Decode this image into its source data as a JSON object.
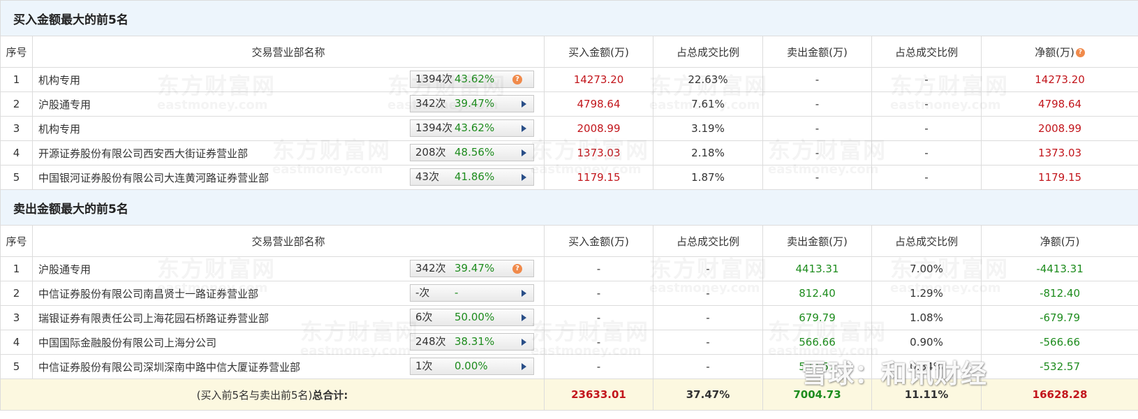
{
  "buy_section": {
    "title": "买入金额最大的前5名",
    "headers": [
      "序号",
      "交易营业部名称",
      "买入金额(万)",
      "占总成交比例",
      "卖出金额(万)",
      "占总成交比例",
      "净额(万)"
    ],
    "rows": [
      {
        "idx": "1",
        "name": "机构专用",
        "count": "1394次",
        "pct": "43.62%",
        "icon": "question-icon",
        "buy": "14273.20",
        "buy_ratio": "22.63%",
        "sell": "-",
        "sell_ratio": "-",
        "net": "14273.20"
      },
      {
        "idx": "2",
        "name": "沪股通专用",
        "count": "342次",
        "pct": "39.47%",
        "icon": "arrow-right-icon",
        "buy": "4798.64",
        "buy_ratio": "7.61%",
        "sell": "-",
        "sell_ratio": "-",
        "net": "4798.64"
      },
      {
        "idx": "3",
        "name": "机构专用",
        "count": "1394次",
        "pct": "43.62%",
        "icon": "arrow-right-icon",
        "buy": "2008.99",
        "buy_ratio": "3.19%",
        "sell": "-",
        "sell_ratio": "-",
        "net": "2008.99"
      },
      {
        "idx": "4",
        "name": "开源证券股份有限公司西安西大街证券营业部",
        "count": "208次",
        "pct": "48.56%",
        "icon": "arrow-right-icon",
        "buy": "1373.03",
        "buy_ratio": "2.18%",
        "sell": "-",
        "sell_ratio": "-",
        "net": "1373.03"
      },
      {
        "idx": "5",
        "name": "中国银河证券股份有限公司大连黄河路证券营业部",
        "count": "43次",
        "pct": "41.86%",
        "icon": "arrow-right-icon",
        "buy": "1179.15",
        "buy_ratio": "1.87%",
        "sell": "-",
        "sell_ratio": "-",
        "net": "1179.15"
      }
    ]
  },
  "sell_section": {
    "title": "卖出金额最大的前5名",
    "headers": [
      "序号",
      "交易营业部名称",
      "买入金额(万)",
      "占总成交比例",
      "卖出金额(万)",
      "占总成交比例",
      "净额(万)"
    ],
    "rows": [
      {
        "idx": "1",
        "name": "沪股通专用",
        "count": "342次",
        "pct": "39.47%",
        "icon": "question-icon",
        "buy": "-",
        "buy_ratio": "-",
        "sell": "4413.31",
        "sell_ratio": "7.00%",
        "net": "-4413.31"
      },
      {
        "idx": "2",
        "name": "中信证券股份有限公司南昌贤士一路证券营业部",
        "count": "-次",
        "pct": "-",
        "icon": "arrow-right-icon",
        "buy": "-",
        "buy_ratio": "-",
        "sell": "812.40",
        "sell_ratio": "1.29%",
        "net": "-812.40"
      },
      {
        "idx": "3",
        "name": "瑞银证券有限责任公司上海花园石桥路证券营业部",
        "count": "6次",
        "pct": "50.00%",
        "icon": "arrow-right-icon",
        "buy": "-",
        "buy_ratio": "-",
        "sell": "679.79",
        "sell_ratio": "1.08%",
        "net": "-679.79"
      },
      {
        "idx": "4",
        "name": "中国国际金融股份有限公司上海分公司",
        "count": "248次",
        "pct": "38.31%",
        "icon": "arrow-right-icon",
        "buy": "-",
        "buy_ratio": "-",
        "sell": "566.66",
        "sell_ratio": "0.90%",
        "net": "-566.66"
      },
      {
        "idx": "5",
        "name": "中信证券股份有限公司深圳深南中路中信大厦证券营业部",
        "count": "1次",
        "pct": "0.00%",
        "icon": "arrow-right-icon",
        "buy": "-",
        "buy_ratio": "-",
        "sell": "532.57",
        "sell_ratio": "0.84%",
        "net": "-532.57"
      }
    ]
  },
  "total": {
    "label_prefix": "(买入前5名与卖出前5名)",
    "label_bold": "总合计:",
    "buy": "23633.01",
    "buy_ratio": "37.47%",
    "sell": "7004.73",
    "sell_ratio": "11.11%",
    "net": "16628.28"
  },
  "watermark": {
    "brand": "东方财富网",
    "domain": "eastmoney.com"
  },
  "overlay_brand": "雪球：和讯财经",
  "colors": {
    "header_bg": "#edf5fc",
    "positive": "#c2161c",
    "negative": "#1e8c1e",
    "total_bg": "#fcf8e0",
    "help_icon": "#f08a4b"
  }
}
